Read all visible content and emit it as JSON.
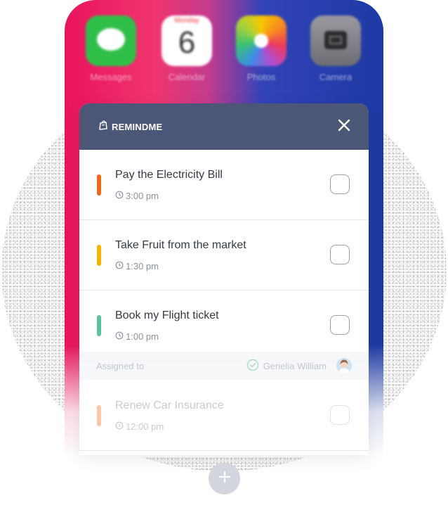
{
  "home_screen": {
    "apps": [
      {
        "name": "Messages"
      },
      {
        "name": "Calendar",
        "weekday": "Monday",
        "date": "6"
      },
      {
        "name": "Photos"
      },
      {
        "name": "Camera"
      }
    ]
  },
  "reminder": {
    "brand": "REMINDME",
    "tasks": [
      {
        "title": "Pay the Electricity Bill",
        "time": "3:00 pm",
        "color": "#f0661a"
      },
      {
        "title": "Take Fruit from the market",
        "time": "1:30 pm",
        "color": "#f5b400"
      },
      {
        "title": "Book my Flight ticket",
        "time": "1:00 pm",
        "color": "#5bc29b"
      },
      {
        "title": "Renew Car Insurance",
        "time": "12:00 pm",
        "color": "#f9c6a8"
      }
    ],
    "assigned": {
      "label": "Assigned to",
      "name": "Genelia William"
    }
  },
  "colors": {
    "header": "#4c5677",
    "add_button": "#d3d6de"
  },
  "icons": {
    "brand": "bag-icon",
    "close": "close-icon",
    "clock": "clock-icon",
    "check": "check-circle-icon",
    "add": "plus-icon"
  }
}
